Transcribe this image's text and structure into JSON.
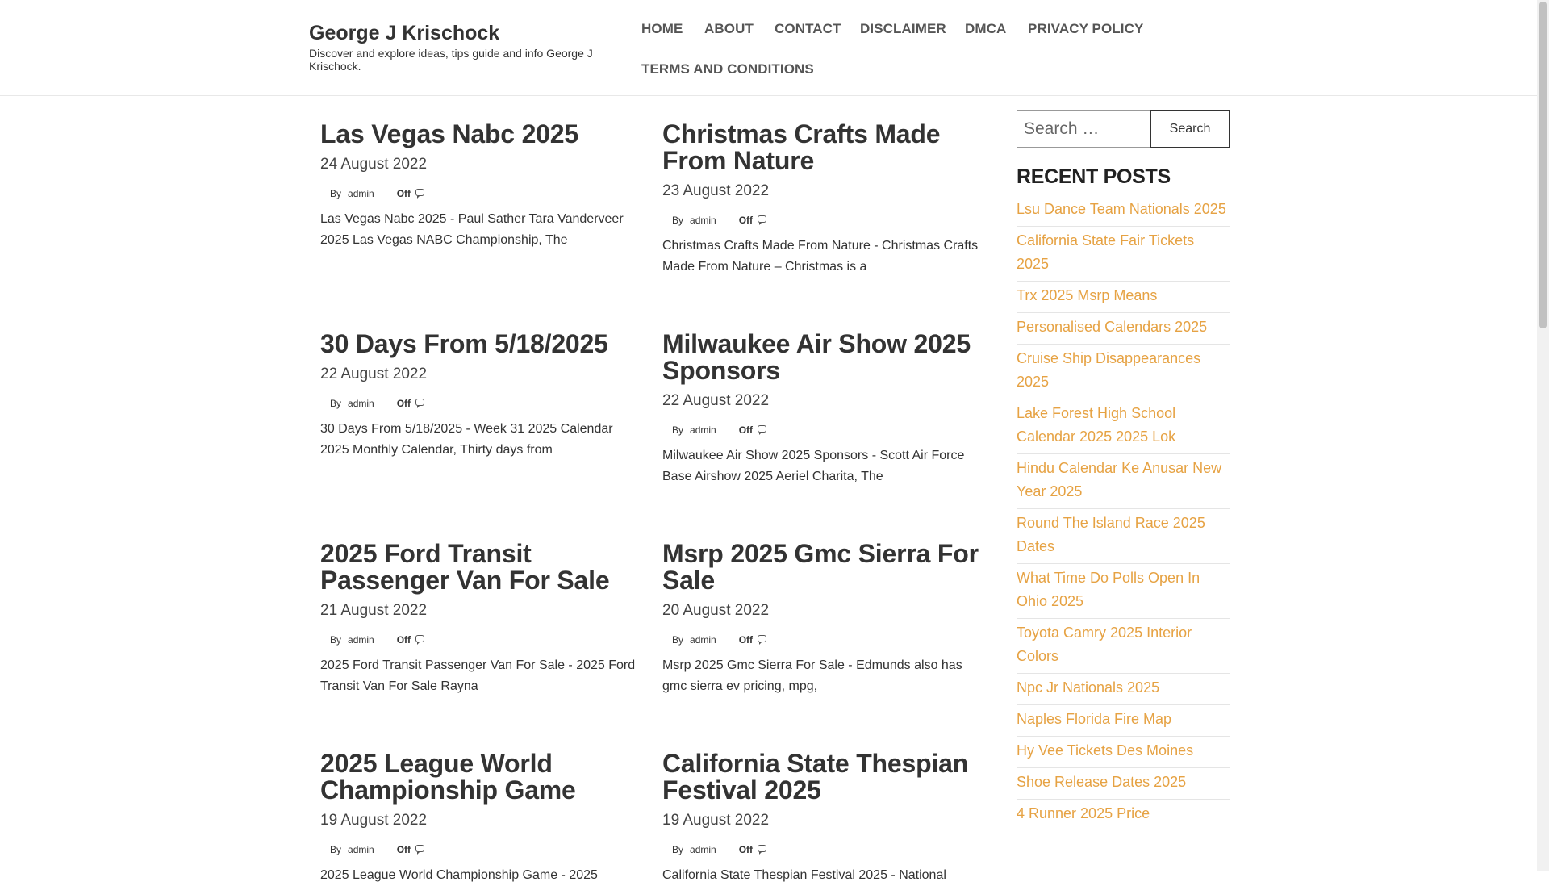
{
  "site": {
    "title": "George J Krischock",
    "description": "Discover and explore ideas, tips guide and info George J Krischock."
  },
  "nav": [
    {
      "label": "HOME"
    },
    {
      "label": "ABOUT"
    },
    {
      "label": "CONTACT"
    },
    {
      "label": "DISCLAIMER"
    },
    {
      "label": "DMCA"
    },
    {
      "label": "PRIVACY POLICY"
    },
    {
      "label": "TERMS AND CONDITIONS"
    }
  ],
  "posts": [
    {
      "title": "Las Vegas Nabc 2025",
      "date": "24 August 2022",
      "by": "By",
      "author": "admin",
      "comments": "Off",
      "excerpt": "Las Vegas Nabc 2025 - Paul Sather Tara Vanderveer 2025 Las Vegas NABC Championship, The"
    },
    {
      "title": "Christmas Crafts Made From Nature",
      "date": "23 August 2022",
      "by": "By",
      "author": "admin",
      "comments": "Off",
      "excerpt": "Christmas Crafts Made From Nature - Christmas Crafts Made From Nature – Christmas is a"
    },
    {
      "title": "30 Days From 5/18/2025",
      "date": "22 August 2022",
      "by": "By",
      "author": "admin",
      "comments": "Off",
      "excerpt": "30 Days From 5/18/2025 - Week 31 2025 Calendar 2025 Monthly Calendar, Thirty days from"
    },
    {
      "title": "Milwaukee Air Show 2025 Sponsors",
      "date": "22 August 2022",
      "by": "By",
      "author": "admin",
      "comments": "Off",
      "excerpt": "Milwaukee Air Show 2025 Sponsors - Scott Air Force Base Airshow 2025 Aeriel Charita, The"
    },
    {
      "title": "2025 Ford Transit Passenger Van For Sale",
      "date": "21 August 2022",
      "by": "By",
      "author": "admin",
      "comments": "Off",
      "excerpt": "2025 Ford Transit Passenger Van For Sale - 2025 Ford Transit Van For Sale Rayna"
    },
    {
      "title": "Msrp 2025 Gmc Sierra For Sale",
      "date": "20 August 2022",
      "by": "By",
      "author": "admin",
      "comments": "Off",
      "excerpt": "Msrp 2025 Gmc Sierra For Sale - Edmunds also has gmc sierra ev pricing, mpg,"
    },
    {
      "title": "2025 League World Championship Game",
      "date": "19 August 2022",
      "by": "By",
      "author": "admin",
      "comments": "Off",
      "excerpt": "2025 League World Championship Game - 2025"
    },
    {
      "title": "California State Thespian Festival 2025",
      "date": "19 August 2022",
      "by": "By",
      "author": "admin",
      "comments": "Off",
      "excerpt": "California State Thespian Festival 2025 - National"
    }
  ],
  "search": {
    "placeholder": "Search …",
    "button_label": "Search"
  },
  "recent_posts": {
    "title": "RECENT POSTS",
    "items": [
      "Lsu Dance Team Nationals 2025",
      "California State Fair Tickets 2025",
      "Trx 2025 Msrp Means",
      "Personalised Calendars 2025",
      "Cruise Ship Disappearances 2025",
      "Lake Forest High School Calendar 2025 2025 Lok",
      "Hindu Calendar Ke Anusar New Year 2025",
      "Round The Island Race 2025 Dates",
      "What Time Do Polls Open In Ohio 2025",
      "Toyota Camry 2025 Interior Colors",
      "Npc Jr Nationals 2025",
      "Naples Florida Fire Map",
      "Hy Vee Tickets Des Moines",
      "Shoe Release Dates 2025",
      "4 Runner 2025 Price"
    ]
  },
  "colors": {
    "link_accent": "#e6a243"
  }
}
